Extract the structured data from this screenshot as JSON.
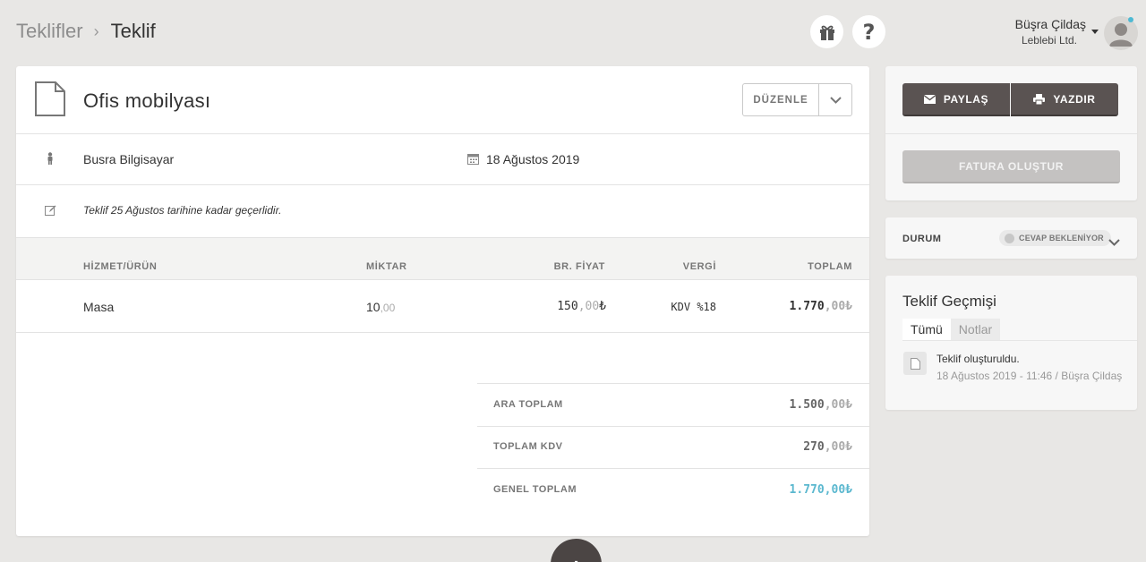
{
  "breadcrumb": {
    "parent": "Teklifler",
    "separator": "›",
    "current": "Teklif"
  },
  "header": {
    "help_symbol": "?"
  },
  "user": {
    "name": "Büşra Çildaş",
    "company": "Leblebi Ltd."
  },
  "offer": {
    "title": "Ofis mobilyası",
    "edit_label": "DÜZENLE",
    "customer": "Busra Bilgisayar",
    "date": "18 Ağustos 2019",
    "note": "Teklif 25 Ağustos tarihine kadar geçerlidir."
  },
  "table": {
    "headers": {
      "item": "HİZMET/ÜRÜN",
      "qty": "MİKTAR",
      "price": "BR. FİYAT",
      "tax": "VERGİ",
      "total": "TOPLAM"
    },
    "rows": [
      {
        "item": "Masa",
        "qty_int": "10",
        "qty_dec": ",00",
        "price_int": "150",
        "price_dec": ",00",
        "currency": "₺",
        "tax": "KDV %18",
        "total_int": "1.770",
        "total_dec": ",00₺"
      }
    ]
  },
  "summary": {
    "subtotal_label": "ARA TOPLAM",
    "subtotal_int": "1.500",
    "subtotal_dec": ",00₺",
    "vat_label": "TOPLAM KDV",
    "vat_int": "270",
    "vat_dec": ",00₺",
    "grand_label": "GENEL TOPLAM",
    "grand_value": "1.770,00₺"
  },
  "fab_symbol": "+",
  "actions": {
    "share_label": "PAYLAŞ",
    "print_label": "YAZDIR",
    "invoice_label": "FATURA OLUŞTUR"
  },
  "status": {
    "label": "DURUM",
    "value": "CEVAP BEKLENİYOR"
  },
  "history": {
    "title": "Teklif Geçmişi",
    "tabs": [
      "Tümü",
      "Notlar"
    ],
    "entries": [
      {
        "text": "Teklif oluşturuldu.",
        "meta": "18 Ağustos 2019 - 11:46 / Büşra Çildaş"
      }
    ]
  },
  "colors": {
    "accent": "#4db9d3",
    "button_dark": "#5a5352",
    "button_disabled": "#c4c2c1",
    "grand_total": "#5bb8cf",
    "background": "#e8e7e5"
  }
}
